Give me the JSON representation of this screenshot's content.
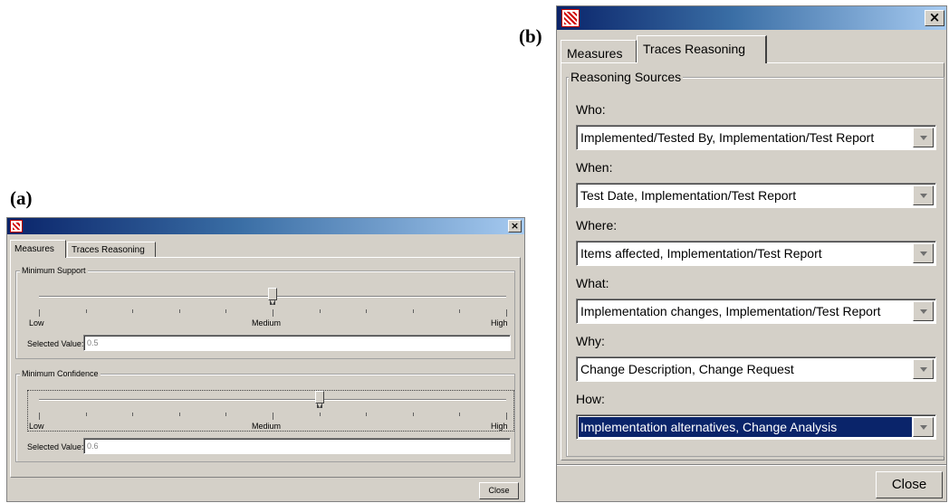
{
  "figure_labels": {
    "a": "(a)",
    "b": "(b)"
  },
  "window_a": {
    "close_glyph": "×",
    "tabs": [
      {
        "label": "Measures",
        "active": true
      },
      {
        "label": "Traces Reasoning",
        "active": false
      }
    ],
    "groups": [
      {
        "title": "Minimum Support",
        "slider": {
          "value": 0.5,
          "low": "Low",
          "medium": "Medium",
          "high": "High"
        },
        "selected_label": "Selected Value:",
        "selected_value": "0.5"
      },
      {
        "title": "Minimum Confidence",
        "slider": {
          "value": 0.6,
          "low": "Low",
          "medium": "Medium",
          "high": "High"
        },
        "selected_label": "Selected Value:",
        "selected_value": "0.6"
      }
    ],
    "close_button": "Close"
  },
  "window_b": {
    "close_glyph": "×",
    "tabs": [
      {
        "label": "Measures",
        "active": false
      },
      {
        "label": "Traces Reasoning",
        "active": true
      }
    ],
    "group_title": "Reasoning Sources",
    "fields": [
      {
        "label": "Who:",
        "value": "Implemented/Tested By, Implementation/Test Report"
      },
      {
        "label": "When:",
        "value": "Test Date, Implementation/Test Report"
      },
      {
        "label": "Where:",
        "value": "Items affected, Implementation/Test Report"
      },
      {
        "label": "What:",
        "value": "Implementation changes, Implementation/Test Report"
      },
      {
        "label": "Why:",
        "value": "Change Description, Change Request"
      },
      {
        "label": "How:",
        "value": "Implementation alternatives, Change Analysis",
        "selected": true
      }
    ],
    "close_button": "Close"
  }
}
